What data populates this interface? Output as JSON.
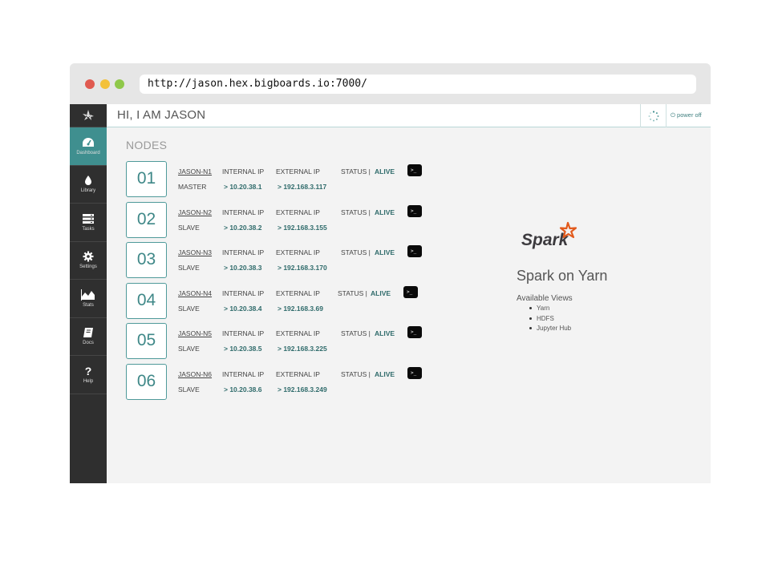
{
  "browser": {
    "url": "http://jason.hex.bigboards.io:7000/"
  },
  "sidebar": {
    "items": [
      {
        "label": "Dashboard",
        "icon": "dashboard-icon",
        "active": true
      },
      {
        "label": "Library",
        "icon": "droplet-icon",
        "active": false
      },
      {
        "label": "Tasks",
        "icon": "tasks-icon",
        "active": false
      },
      {
        "label": "Settings",
        "icon": "gear-icon",
        "active": false
      },
      {
        "label": "Stats",
        "icon": "area-chart-icon",
        "active": false
      },
      {
        "label": "Docs",
        "icon": "book-icon",
        "active": false
      },
      {
        "label": "Help",
        "icon": "question-icon",
        "active": false
      }
    ]
  },
  "header": {
    "greeting": "HI, I AM JASON",
    "power_label": "power off"
  },
  "nodes": {
    "title": "NODES",
    "internal_label": "INTERNAL IP",
    "external_label": "EXTERNAL IP",
    "status_label": "STATUS |",
    "items": [
      {
        "num": "01",
        "name": "JASON-N1",
        "role": "MASTER",
        "internal_ip": "> 10.20.38.1",
        "external_ip": "> 192.168.3.117",
        "status": "ALIVE"
      },
      {
        "num": "02",
        "name": "JASON-N2",
        "role": "SLAVE",
        "internal_ip": "> 10.20.38.2",
        "external_ip": "> 192.168.3.155",
        "status": "ALIVE"
      },
      {
        "num": "03",
        "name": "JASON-N3",
        "role": "SLAVE",
        "internal_ip": "> 10.20.38.3",
        "external_ip": "> 192.168.3.170",
        "status": "ALIVE"
      },
      {
        "num": "04",
        "name": "JASON-N4",
        "role": "SLAVE",
        "internal_ip": "> 10.20.38.4",
        "external_ip": "> 192.168.3.69",
        "status": "ALIVE"
      },
      {
        "num": "05",
        "name": "JASON-N5",
        "role": "SLAVE",
        "internal_ip": "> 10.20.38.5",
        "external_ip": "> 192.168.3.225",
        "status": "ALIVE"
      },
      {
        "num": "06",
        "name": "JASON-N6",
        "role": "SLAVE",
        "internal_ip": "> 10.20.38.6",
        "external_ip": "> 192.168.3.249",
        "status": "ALIVE"
      }
    ],
    "terminal_glyph": ">_"
  },
  "app": {
    "logo_text": "Spark",
    "title": "Spark on Yarn",
    "views_title": "Available Views",
    "views": [
      "Yarn",
      "HDFS",
      "Jupyter Hub"
    ]
  },
  "colors": {
    "accent": "#3f8f8f",
    "sidebar": "#2f2f2f",
    "spark_orange": "#e25a1c"
  }
}
